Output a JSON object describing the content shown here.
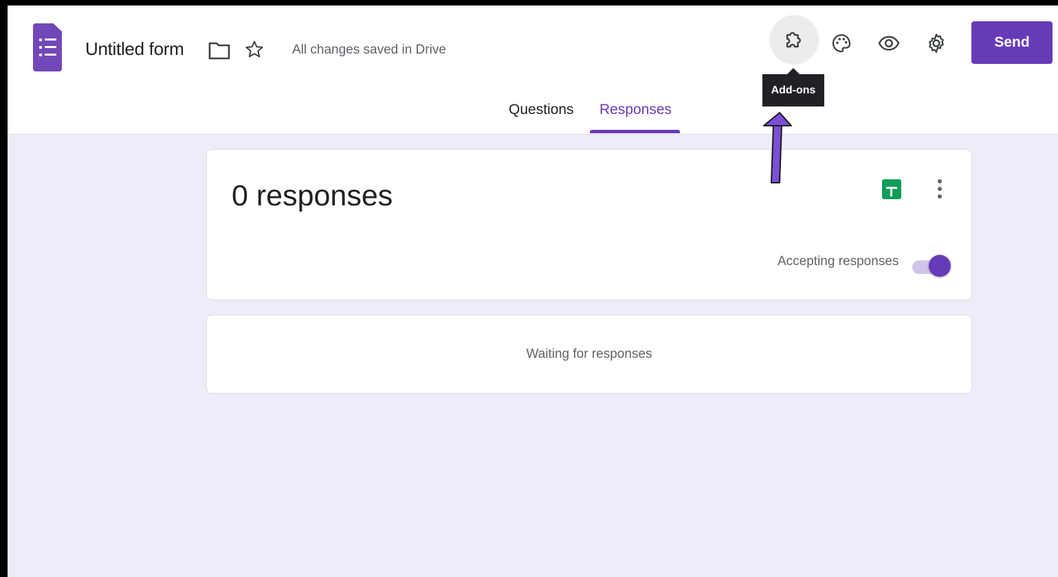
{
  "header": {
    "form_title": "Untitled form",
    "save_status": "All changes saved in Drive",
    "send_label": "Send",
    "addons_tooltip": "Add-ons",
    "icons": [
      "forms-logo-icon",
      "folder-icon",
      "star-icon",
      "addons-puzzle-icon",
      "palette-icon",
      "preview-eye-icon",
      "settings-gear-icon"
    ]
  },
  "tabs": [
    {
      "label": "Questions",
      "active": false
    },
    {
      "label": "Responses",
      "active": true
    }
  ],
  "responses": {
    "count_label": "0 responses",
    "accepting_label": "Accepting responses",
    "accepting": true,
    "waiting_text": "Waiting for responses"
  },
  "colors": {
    "accent": "#673ab7",
    "page_background": "#f0ebf8",
    "sheets_green": "#0f9d58",
    "annotation_arrow": "#7b4fd6"
  }
}
